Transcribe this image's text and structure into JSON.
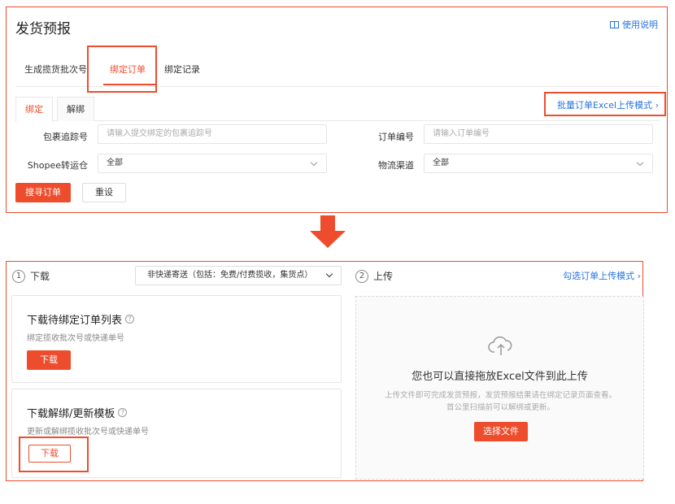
{
  "header": {
    "title": "发货预报",
    "help_label": "使用说明"
  },
  "main_tabs": [
    {
      "label": "生成揽货批次号"
    },
    {
      "label": "绑定订单"
    },
    {
      "label": "绑定记录"
    }
  ],
  "sub_tabs": [
    {
      "label": "绑定"
    },
    {
      "label": "解绑"
    }
  ],
  "batch_upload_link": "批量订单Excel上传模式",
  "form": {
    "tracking_label": "包裹追踪号",
    "tracking_placeholder": "请输入提交绑定的包裹追踪号",
    "order_label": "订单编号",
    "order_placeholder": "请输入订单编号",
    "warehouse_label": "Shopee转运仓",
    "warehouse_value": "全部",
    "channel_label": "物流渠道",
    "channel_value": "全部",
    "search_button": "搜寻订单",
    "reset_button": "重设"
  },
  "download_section": {
    "step_number": "1",
    "step_label": "下载",
    "dropdown_value": "非快递寄送（包括：免费/付费揽收，集货点）",
    "cards": [
      {
        "title": "下载待绑定订单列表",
        "subtitle": "绑定揽收批次号或快递单号",
        "button": "下载"
      },
      {
        "title": "下载解绑/更新模板",
        "subtitle": "更新或解绑揽收批次号或快递单号",
        "button": "下载"
      }
    ]
  },
  "upload_section": {
    "step_number": "2",
    "step_label": "上传",
    "link": "勾选订单上传模式",
    "title": "您也可以直接拖放Excel文件到此上传",
    "description": "上传文件即可完成发货预报，发货预报结果请在绑定记录页面查看。首公里扫描前可以解绑或更新。",
    "button": "选择文件"
  },
  "colors": {
    "accent": "#ee4d2d",
    "link": "#2673dd"
  },
  "icons": {
    "help": "book-icon",
    "arrow": "down-arrow-icon",
    "upload": "cloud-upload-icon"
  }
}
